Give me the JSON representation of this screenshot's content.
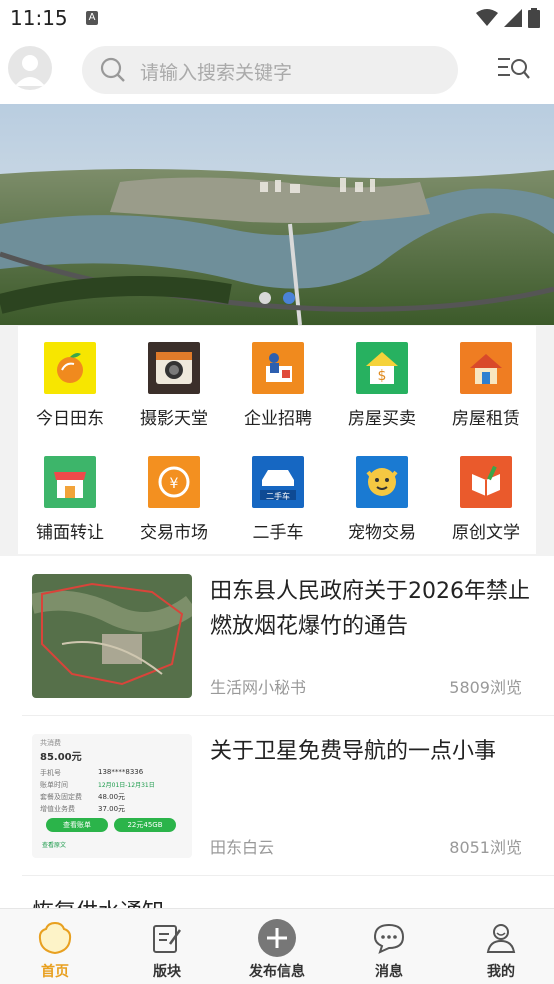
{
  "status": {
    "time": "11:15",
    "notif_icon_letter": "A"
  },
  "search": {
    "placeholder": "请输入搜索关键字"
  },
  "grid": {
    "items": [
      {
        "label": "今日田东",
        "icon": "orange-fruit-icon",
        "color": "#f7e600"
      },
      {
        "label": "摄影天堂",
        "icon": "camera-icon",
        "color": "#3b2f2a"
      },
      {
        "label": "企业招聘",
        "icon": "recruit-icon",
        "color": "#f08a1e"
      },
      {
        "label": "房屋买卖",
        "icon": "house-sale-icon",
        "color": "#27b160"
      },
      {
        "label": "房屋租赁",
        "icon": "house-rent-icon",
        "color": "#ef7d22"
      },
      {
        "label": "铺面转让",
        "icon": "shop-icon",
        "color": "#3db56a"
      },
      {
        "label": "交易市场",
        "icon": "trade-icon",
        "color": "#f39020"
      },
      {
        "label": "二手车",
        "icon": "used-car-icon",
        "color": "#1667c2"
      },
      {
        "label": "宠物交易",
        "icon": "pet-icon",
        "color": "#1a7ad2"
      },
      {
        "label": "原创文学",
        "icon": "literature-icon",
        "color": "#ea5a2c"
      }
    ]
  },
  "feed": {
    "items": [
      {
        "title": "田东县人民政府关于2026年禁止燃放烟花爆竹的通告",
        "author": "生活网小秘书",
        "views": "5809浏览"
      },
      {
        "title": "关于卫星免费导航的一点小事",
        "author": "田东白云",
        "views": "8051浏览"
      },
      {
        "title": "恢复供水通知"
      }
    ]
  },
  "thumb2": {
    "label_total": "共消费",
    "amount": "85.00元",
    "phone_label": "手机号",
    "phone": "138****8336",
    "period_label": "账单时间",
    "period": "12月01日-12月31日",
    "fee_label": "套餐及固定费",
    "fee": "48.00元",
    "extra_label": "增值业务费",
    "extra": "37.00元",
    "btn1": "查看账单",
    "btn2": "22元45GB",
    "link": "查看原文"
  },
  "tabbar": {
    "tabs": [
      {
        "label": "首页",
        "icon": "home-icon"
      },
      {
        "label": "版块",
        "icon": "edit-icon"
      },
      {
        "label": "发布信息",
        "icon": "plus-circle-icon"
      },
      {
        "label": "消息",
        "icon": "chat-icon"
      },
      {
        "label": "我的",
        "icon": "user-icon"
      }
    ],
    "active_color": "#e8a020"
  }
}
